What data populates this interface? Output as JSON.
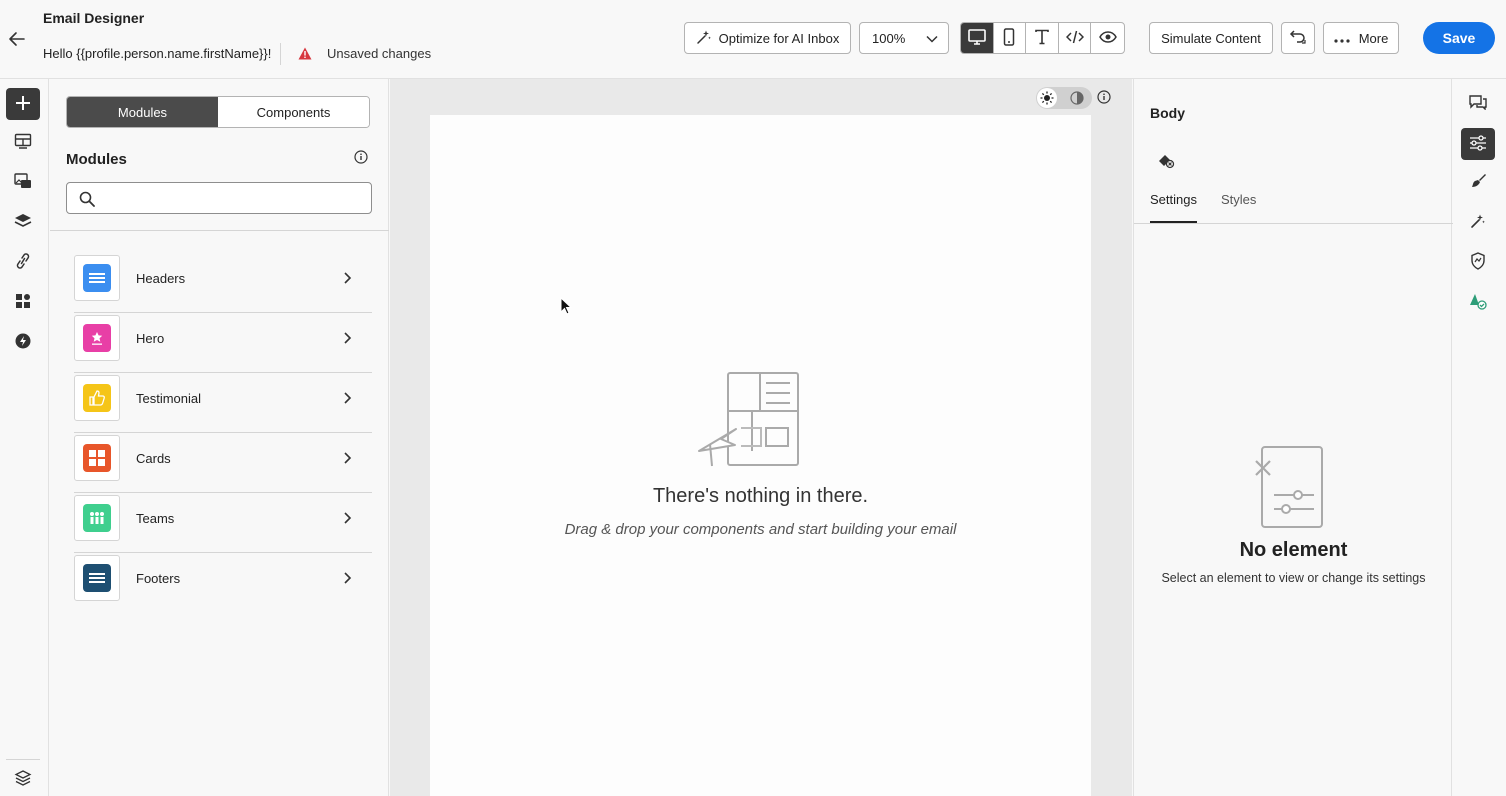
{
  "header": {
    "app_title": "Email Designer",
    "subject": "Hello {{profile.person.name.firstName}}!",
    "status": "Unsaved changes",
    "optimize_label": "Optimize for AI Inbox",
    "zoom_value": "100%",
    "simulate_label": "Simulate Content",
    "more_label": "More",
    "save_label": "Save",
    "view_modes": [
      "desktop-icon",
      "mobile-icon",
      "text-icon",
      "code-icon",
      "preview-icon"
    ],
    "active_view": "desktop-icon"
  },
  "left_rail": {
    "items": [
      "add-icon",
      "structures-icon",
      "media-icon",
      "layers-icon",
      "link-icon",
      "fragments-icon",
      "lightning-icon"
    ],
    "bottom": "layers-stack-icon"
  },
  "modules_panel": {
    "segments": [
      "Modules",
      "Components"
    ],
    "active_segment": "Modules",
    "title": "Modules",
    "search_placeholder": "",
    "items": [
      {
        "label": "Headers",
        "color": "#3b8ef0"
      },
      {
        "label": "Hero",
        "color": "#e83fa6"
      },
      {
        "label": "Testimonial",
        "color": "#f5c518"
      },
      {
        "label": "Cards",
        "color": "#e8562a"
      },
      {
        "label": "Teams",
        "color": "#3fcf8e"
      },
      {
        "label": "Footers",
        "color": "#1e4f72"
      }
    ]
  },
  "canvas": {
    "empty_title": "There's nothing in there.",
    "empty_subtitle": "Drag & drop your components and start building your email"
  },
  "properties": {
    "title": "Body",
    "tabs": [
      "Settings",
      "Styles"
    ],
    "active_tab": "Settings",
    "empty_title": "No element",
    "empty_subtitle": "Select an element to view or change its settings"
  },
  "right_rail": {
    "items": [
      "comments-icon",
      "settings-sliders-icon",
      "brush-icon",
      "magic-icon",
      "accessibility-icon",
      "brand-check-icon"
    ],
    "active": "settings-sliders-icon"
  },
  "colors": {
    "accent": "#1473e6",
    "warning": "#d7373f",
    "dark": "#3a3a3a"
  }
}
